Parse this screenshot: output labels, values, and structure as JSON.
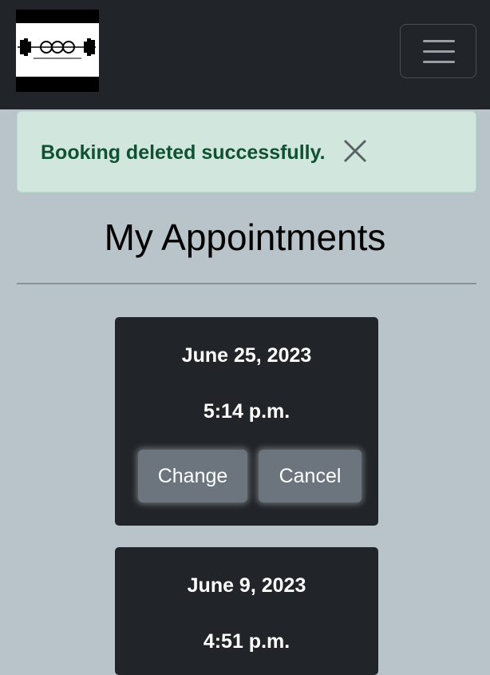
{
  "navbar": {
    "logo_alt": "OCC logo",
    "logo_text": "OCC",
    "menu_button_icon": "hamburger-menu-icon"
  },
  "alert": {
    "message": "Booking deleted successfully.",
    "close_icon": "close-icon",
    "colors": {
      "background": "#d1e7dd",
      "text": "#0f5132"
    }
  },
  "page": {
    "title": "My Appointments"
  },
  "appointments": [
    {
      "date": "June 25, 2023",
      "time": "5:14 p.m.",
      "change_label": "Change",
      "cancel_label": "Cancel"
    },
    {
      "date": "June 9, 2023",
      "time": "4:51 p.m."
    }
  ],
  "colors": {
    "page_background": "#b9c3ca",
    "navbar": "#212529",
    "card": "#212529",
    "button": "#6c757d"
  }
}
